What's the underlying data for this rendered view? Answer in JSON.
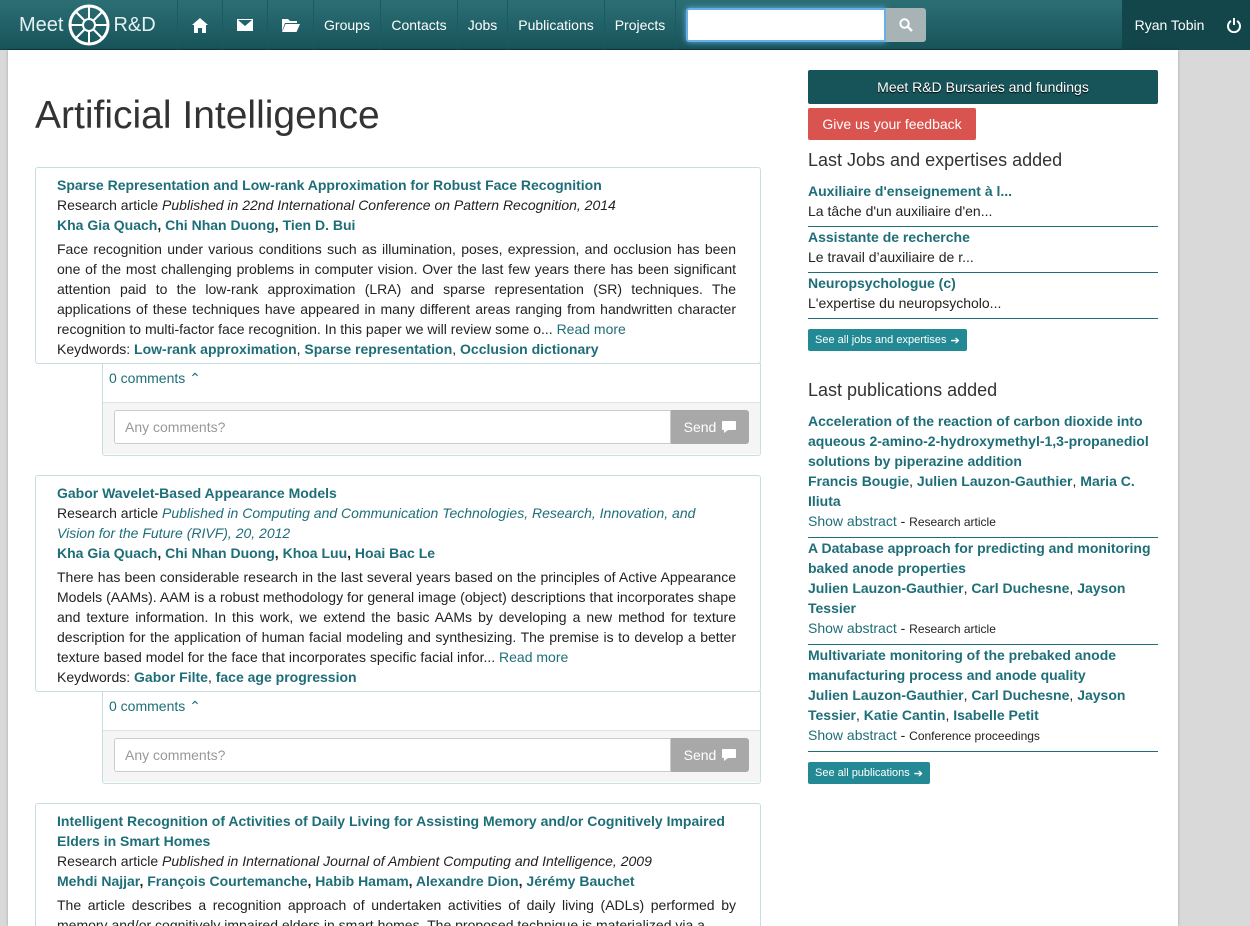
{
  "nav": {
    "brand_left": "Meet",
    "brand_right": "R&D",
    "links": [
      "Groups",
      "Contacts",
      "Jobs",
      "Publications",
      "Projects"
    ],
    "search_value": "",
    "user_name": "Ryan Tobin"
  },
  "page_title": "Artificial Intelligence",
  "articles": [
    {
      "title": "Sparse Representation and Low-rank Approximation for Robust Face Recognition",
      "type": "Research article",
      "published": "Published in 22nd International Conference on Pattern Recognition, 2014",
      "authors": [
        "Kha Gia Quach",
        "Chi Nhan Duong",
        "Tien D. Bui"
      ],
      "abstract": "Face recognition under various conditions such as illumination, poses, expression, and occlusion has been one of the most challenging problems in computer vision. Over the last few years there has been significant attention paid to the low-rank approximation (LRA) and sparse representation (SR) techniques. The applications of these techniques have appeared in many different areas ranging from handwritten character recognition to multi-factor face recognition. In this paper we will review some o...",
      "read_more": "Read more",
      "keywords_label": "Keydwords:",
      "keywords": [
        "Low-rank approximation",
        "Sparse representation",
        "Occlusion dictionary"
      ],
      "comments_count": "0 comments",
      "comment_placeholder": "Any comments?",
      "send_label": "Send"
    },
    {
      "title": "Gabor Wavelet-Based Appearance Models",
      "type": "Research article",
      "published": "Published in Computing and Communication Technologies, Research, Innovation, and Vision for the Future (RIVF), 20, 2012",
      "authors": [
        "Kha Gia Quach",
        "Chi Nhan Duong",
        "Khoa Luu",
        "Hoai Bac Le"
      ],
      "abstract": "There has been considerable research in the last several years based on the principles of Active Appearance Models (AAMs). AAM is a robust methodology for general image (object) descriptions that incorporates shape and texture information. In this work, we extend the basic AAMs by developing a new method for texture description for the application of human facial modeling and synthesizing. The premise is to develop a better texture based model for the face that incorporates specific facial infor...",
      "read_more": "Read more",
      "keywords_label": "Keydwords:",
      "keywords": [
        "Gabor Filte",
        "face age progression"
      ],
      "comments_count": "0 comments",
      "comment_placeholder": "Any comments?",
      "send_label": "Send"
    },
    {
      "title": "Intelligent Recognition of Activities of Daily Living for Assisting Memory and/or Cognitively Impaired Elders in Smart Homes",
      "type": "Research article",
      "published": "Published in International Journal of Ambient Computing and Intelligence, 2009",
      "authors": [
        "Mehdi Najjar",
        "François Courtemanche",
        "Habib Hamam",
        "Alexandre Dion",
        "Jérémy Bauchet"
      ],
      "abstract": "The article describes a recognition approach of undertaken activities of daily living (ADLs) performed by memory and/or cognitively impaired elders in smart homes. The proposed technique is materialized via a"
    }
  ],
  "sidebar": {
    "bursary_label": "Meet R&D Bursaries and fundings",
    "feedback_label": "Give us your feedback",
    "jobs_heading": "Last Jobs and expertises added",
    "jobs": [
      {
        "title": "Auxiliaire d'enseignement à l...",
        "desc": "La tâche d'un auxiliaire d'en..."
      },
      {
        "title": "Assistante de recherche",
        "desc": "Le travail d’auxiliaire de r..."
      },
      {
        "title": "Neuropsychologue (c)",
        "desc": "L'expertise du neuropsycholo..."
      }
    ],
    "jobs_button": "See all jobs and expertises",
    "pubs_heading": "Last publications added",
    "publications": [
      {
        "title": "Acceleration of the reaction of carbon dioxide into aqueous 2-amino-2-hydroxymethyl-1,3-propanediol solutions by piperazine addition",
        "authors": [
          "Francis Bougie",
          "Julien Lauzon-Gauthier",
          "Maria C. Iliuta"
        ],
        "show_abstract": "Show abstract",
        "type": "Research article"
      },
      {
        "title": "A Database approach for predicting and monitoring baked anode properties",
        "authors": [
          "Julien Lauzon-Gauthier",
          "Carl Duchesne",
          "Jayson Tessier"
        ],
        "show_abstract": "Show abstract",
        "type": "Research article"
      },
      {
        "title": "Multivariate monitoring of the prebaked anode manufacturing process and anode quality",
        "authors": [
          "Julien Lauzon-Gauthier",
          "Carl Duchesne",
          "Jayson Tessier",
          "Katie Cantin",
          "Isabelle Petit"
        ],
        "show_abstract": "Show abstract",
        "type": "Conference proceedings"
      }
    ],
    "pubs_button": "See all publications"
  },
  "colors": {
    "navbar": "#17545a",
    "link": "#1e6e78",
    "feedback": "#d9534f",
    "small_button": "#238a95"
  }
}
